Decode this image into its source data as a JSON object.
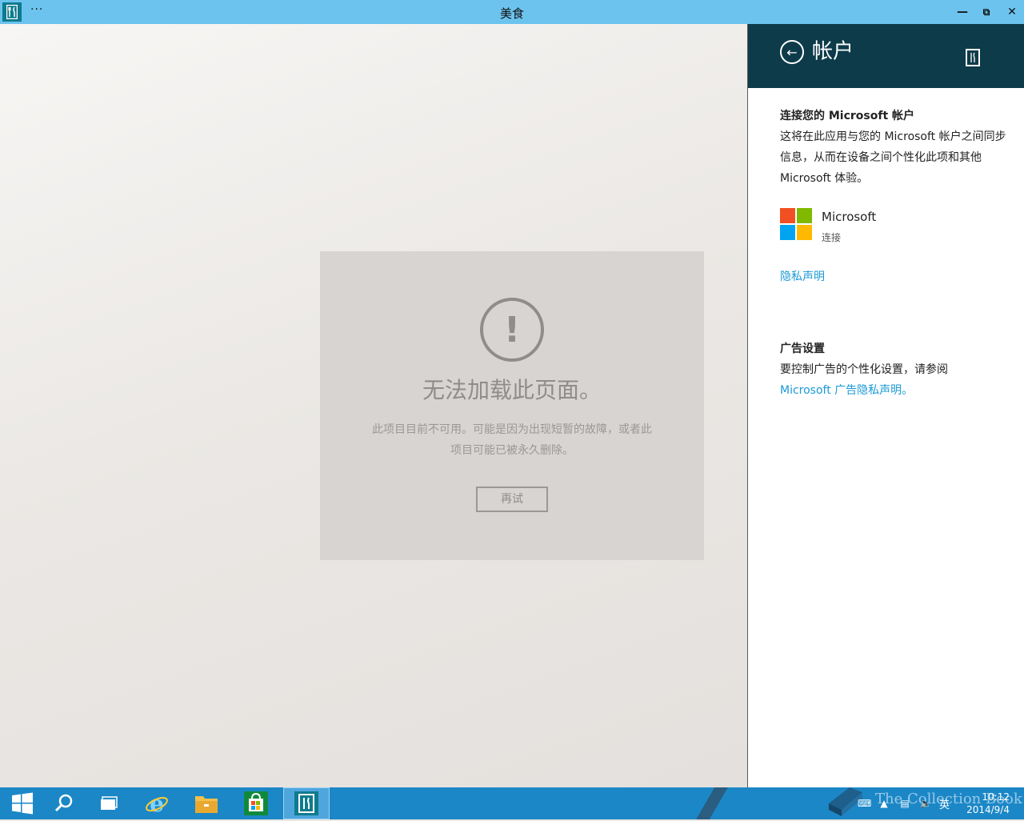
{
  "window": {
    "title": "美食",
    "menu_dots": "···"
  },
  "error": {
    "icon": "!",
    "title": "无法加载此页面。",
    "message": "此项目目前不可用。可能是因为出现短暂的故障，或者此项目可能已被永久删除。",
    "retry": "再试"
  },
  "pane": {
    "title": "帐户",
    "connect_heading": "连接您的 Microsoft 帐户",
    "connect_body": "这将在此应用与您的 Microsoft 帐户之间同步信息，从而在设备之间个性化此项和其他 Microsoft 体验。",
    "account_name": "Microsoft",
    "account_action": "连接",
    "privacy_link": "隐私声明",
    "ads_heading": "广告设置",
    "ads_body": "要控制广告的个性化设置，请参阅",
    "ads_link": "Microsoft 广告隐私声明。"
  },
  "taskbar": {
    "ime": "英",
    "time": "10:12",
    "date": "2014/9/4",
    "watermark": "The Collection Book"
  },
  "colors": {
    "titlebar": "#6cc4ee",
    "pane_header": "#0d3b4a",
    "taskbar": "#1b87c7",
    "link": "#1b9ad6",
    "ms_red": "#f25022",
    "ms_green": "#7fba00",
    "ms_blue": "#00a4ef",
    "ms_yellow": "#ffb900"
  },
  "icons": [
    "app-fork-knife-icon",
    "minimize-icon",
    "restore-icon",
    "close-icon",
    "back-arrow-icon",
    "warning-icon",
    "windows-start-icon",
    "search-icon",
    "task-view-icon",
    "internet-explorer-icon",
    "file-explorer-icon",
    "store-icon",
    "food-app-icon",
    "keyboard-icon",
    "tray-chevron-icon",
    "network-icon",
    "volume-icon"
  ]
}
